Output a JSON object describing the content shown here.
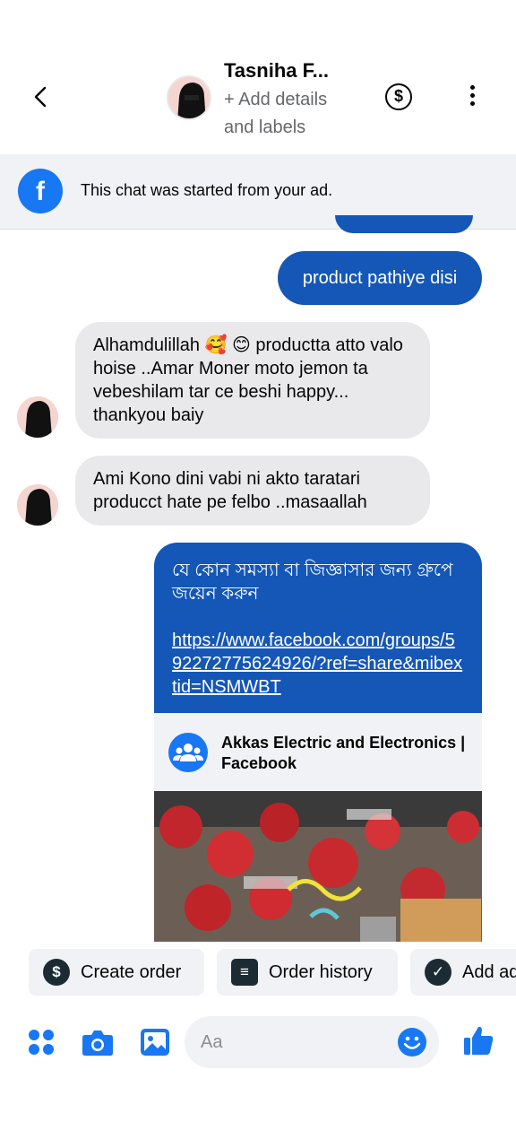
{
  "header": {
    "name": "Tasniha F...",
    "add_details": "+ Add details and labels",
    "currency_symbol": "$"
  },
  "ad_banner": {
    "text": "This chat was started from your ad.",
    "icon": "f"
  },
  "messages": [
    {
      "direction": "out",
      "text": "product pathiye disi"
    },
    {
      "direction": "in",
      "text": "Alhamdulillah 🥰 😊 productta atto valo hoise ..Amar Moner moto jemon ta vebeshilam tar ce beshi happy... thankyou baiy"
    },
    {
      "direction": "in",
      "text": "Ami Kono dini vabi ni akto taratari producct hate pe felbo ..masaallah"
    }
  ],
  "link_message": {
    "text": "যে কোন সমস্যা বা জিজ্ঞাসার জন্য গ্রুপে জয়েন করুন",
    "url": "https://www.facebook.com/groups/592272775624926/?ref=share&mibextid=NSMWBT",
    "preview_title": "Akkas Electric and Electronics | Facebook"
  },
  "quick_actions": [
    {
      "label": "Create order",
      "icon": "dollar-icon"
    },
    {
      "label": "Order history",
      "icon": "list-icon"
    },
    {
      "label": "Add ad",
      "icon": "check-icon"
    }
  ],
  "composer": {
    "placeholder": "Aa"
  },
  "colors": {
    "brand_blue": "#1877f2",
    "bubble_out": "#1457b6",
    "bubble_in": "#e9e9eb"
  }
}
